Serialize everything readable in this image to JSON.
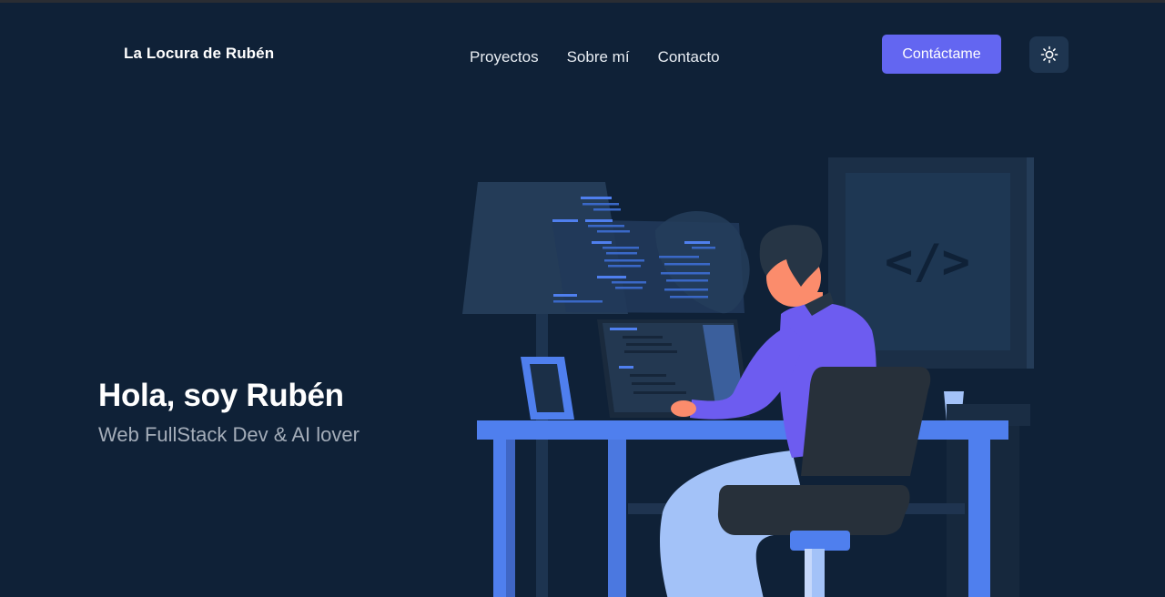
{
  "header": {
    "brand": "La Locura de Rubén",
    "nav": [
      {
        "label": "Proyectos"
      },
      {
        "label": "Sobre mí"
      },
      {
        "label": "Contacto"
      }
    ],
    "cta_label": "Contáctame",
    "theme_toggle_icon": "sun-icon"
  },
  "hero": {
    "title": "Hola, soy Rubén",
    "subtitle": "Web FullStack Dev & AI lover",
    "code_sign": "</>",
    "illustration_icon": "developer-at-desk-illustration"
  },
  "colors": {
    "background": "#0f2137",
    "accent": "#6366f1",
    "toggle_bg": "#1e3550",
    "desk_blue": "#4f7fee",
    "shirt": "#6d5cf0",
    "chair": "#27303a"
  }
}
